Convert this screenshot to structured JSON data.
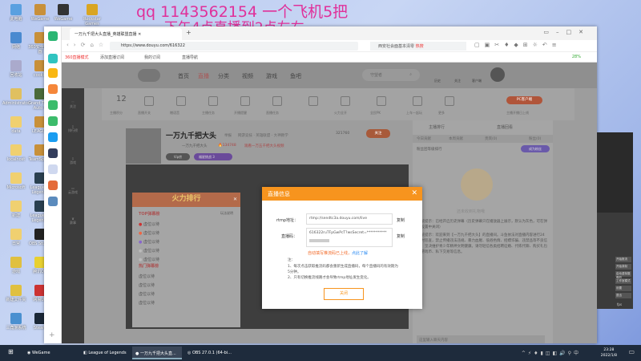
{
  "overlay": {
    "line1": "qq 1143562154  一个飞机5把",
    "line2": "下午4点直播到2点左右"
  },
  "desktop_icons": [
    "此电脑",
    "WeGame",
    "WeGame",
    "Rockstar Games",
    "网络",
    "360安全浏览器",
    "回收站",
    "cookie",
    "Administrator",
    "Grand Theft Auto V",
    "data",
    "LEAGUE",
    "localhost",
    "TeamSpeak",
    "Microsoft",
    "League of Legends",
    "新建",
    "League of Legends",
    "日常",
    "OBS Studio",
    "游戏",
    "腾讯QQ",
    "新建文件夹",
    "网易UU",
    "三角洲系统",
    "Steam"
  ],
  "browser": {
    "tab_title": "一万九千把大头直播_英雄联盟直播",
    "url": "https://www.douyu.com/616322",
    "search_placeholder": "西安社会面基本清零",
    "search_badge": "热搜",
    "bookmarks": [
      "360直播模式",
      "添加直播订阅",
      "我的订阅",
      "直播导航"
    ],
    "zoom": "28%"
  },
  "site": {
    "nav": [
      "首页",
      "直播",
      "分类",
      "视频",
      "游戏",
      "鱼吧"
    ],
    "search_placeholder": "守望者",
    "nav_right": [
      "历史",
      "关注",
      "客户端"
    ],
    "left_sidebar": [
      "关注",
      "排行榜",
      "游戏",
      "云游戏",
      "赛事"
    ],
    "toolbar": {
      "level": "12",
      "level_label": "主播积分",
      "items": [
        "直播开关",
        "赠语音",
        "主播任务",
        "开播提醒",
        "直播任务",
        "",
        "火力全开",
        "全民PK",
        "上车一起玩",
        "更多"
      ],
      "pc_button": "PC客户端",
      "pc_sub": "主播开播日上线"
    },
    "streamer": {
      "name": "一万九千把大头",
      "tag": "举报",
      "category": "网游竞技 · 英雄联盟 · 大神教学",
      "sub_name": "一万九千把大头",
      "hot": "134748",
      "promo": "观看一万五千把大头视频",
      "followers": "321760",
      "follow_btn": "关注",
      "badges": [
        "Vip房",
        "福星挑战",
        "3"
      ]
    },
    "rank": {
      "title": "火力排行",
      "top_label": "TOP弹幕榜",
      "rule": "玩法说明",
      "hot_label": "热门弹幕榜",
      "items": [
        "虚位以待",
        "虚位以待",
        "虚位以待",
        "虚位以待",
        "虚位以待"
      ],
      "hot_items": [
        "虚位以待",
        "虚位以待",
        "虚位以待",
        "虚位以待"
      ]
    },
    "chat": {
      "tabs_top": [
        "主播排行",
        "直播回看"
      ],
      "tabs": [
        "今日贡献",
        "本周贡献",
        "贵宾(0)",
        "粉丝(0)"
      ],
      "fan_rank": "粉丝团等级排行",
      "become_fan": "成为粉丝",
      "empty": "还未收到礼物哦",
      "msgs": [
        "系统提示：已经开启历史弹幕（历史弹幕只在播放器上展示，默认为灰色，可在弹幕设置中关闭）",
        "系统提示：欢迎来到【一万九千把大头】的直播间。斗鱼依法对直播内容进行24小时巡查，禁止传播违法违规、暴力血腥、低俗色情、招嫖诈骗、违禁品等不良信息，坚决维护青少年精神文明健康。请勿轻信各类招聘征婚、代练代聊、购买礼包码游戏币、私下交易等信息。"
      ],
      "input_placeholder": "这里输入聊天内容"
    }
  },
  "dialog": {
    "title": "直播信息",
    "rtmp_label": "rtmp地址：",
    "rtmp_value": "rtmp://sendtc3a.douyu.com/live",
    "code_label": "直播码：",
    "code_value": "616322ruTFpGwPcT?wsSecret=***********",
    "copy": "复制",
    "copy2": "复制",
    "warn": "自动填写推流码已上线，",
    "link": "点此了解",
    "note_title": "注：",
    "note1": "1、每次点击获取推流码都会重新生成直播码，每个直播码的有效期为5分钟。",
    "note2": "2、只有切换推流线路才会导致rtmp地址发生变化。",
    "close_btn": "关闭"
  },
  "obs": {
    "items": [
      "开始推流",
      "开始录制",
      "启动虚拟摄像机",
      "工作室模式",
      "设置",
      "退出"
    ],
    "fps": "fps"
  },
  "taskbar": {
    "apps": [
      "WeGame",
      "League of Legends",
      "一万九千把大头直...",
      "OBS 27.0.1 (64-bi..."
    ],
    "time": "23:28",
    "date": "2022/1/8"
  },
  "colors": {
    "accent": "#f7941e",
    "overlay_text": "#e0309a"
  }
}
